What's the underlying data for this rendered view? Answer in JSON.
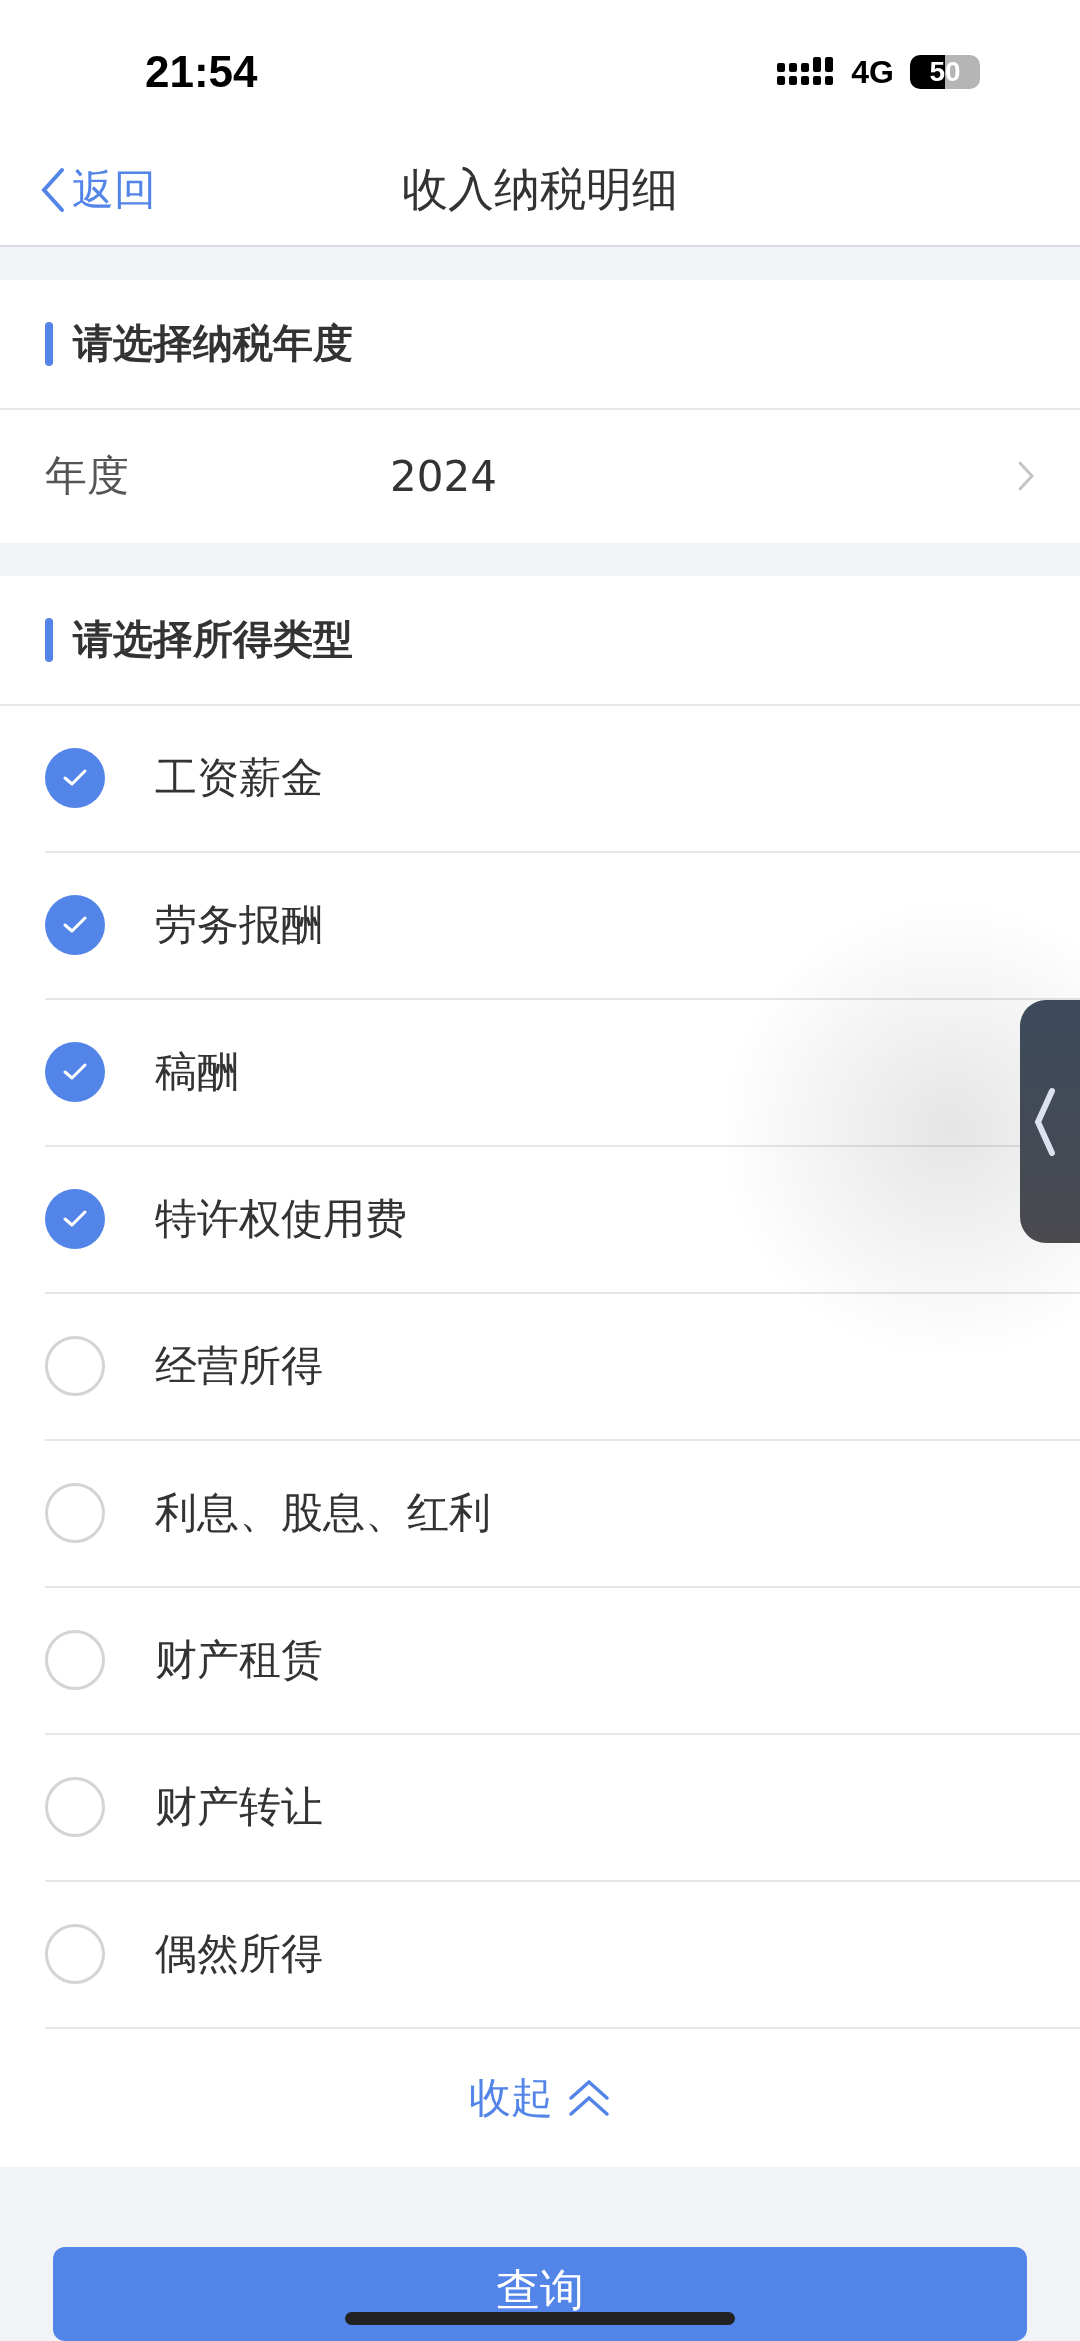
{
  "status_bar": {
    "time": "21:54",
    "network": "4G",
    "battery": "50"
  },
  "nav": {
    "back": "返回",
    "title": "收入纳税明细"
  },
  "year_section": {
    "title": "请选择纳税年度",
    "label": "年度",
    "value": "2024"
  },
  "income_section": {
    "title": "请选择所得类型",
    "items": [
      {
        "label": "工资薪金",
        "checked": true
      },
      {
        "label": "劳务报酬",
        "checked": true
      },
      {
        "label": "稿酬",
        "checked": true
      },
      {
        "label": "特许权使用费",
        "checked": true
      },
      {
        "label": "经营所得",
        "checked": false
      },
      {
        "label": "利息、股息、红利",
        "checked": false
      },
      {
        "label": "财产租赁",
        "checked": false
      },
      {
        "label": "财产转让",
        "checked": false
      },
      {
        "label": "偶然所得",
        "checked": false
      }
    ],
    "collapse": "收起"
  },
  "query_button": "查询"
}
